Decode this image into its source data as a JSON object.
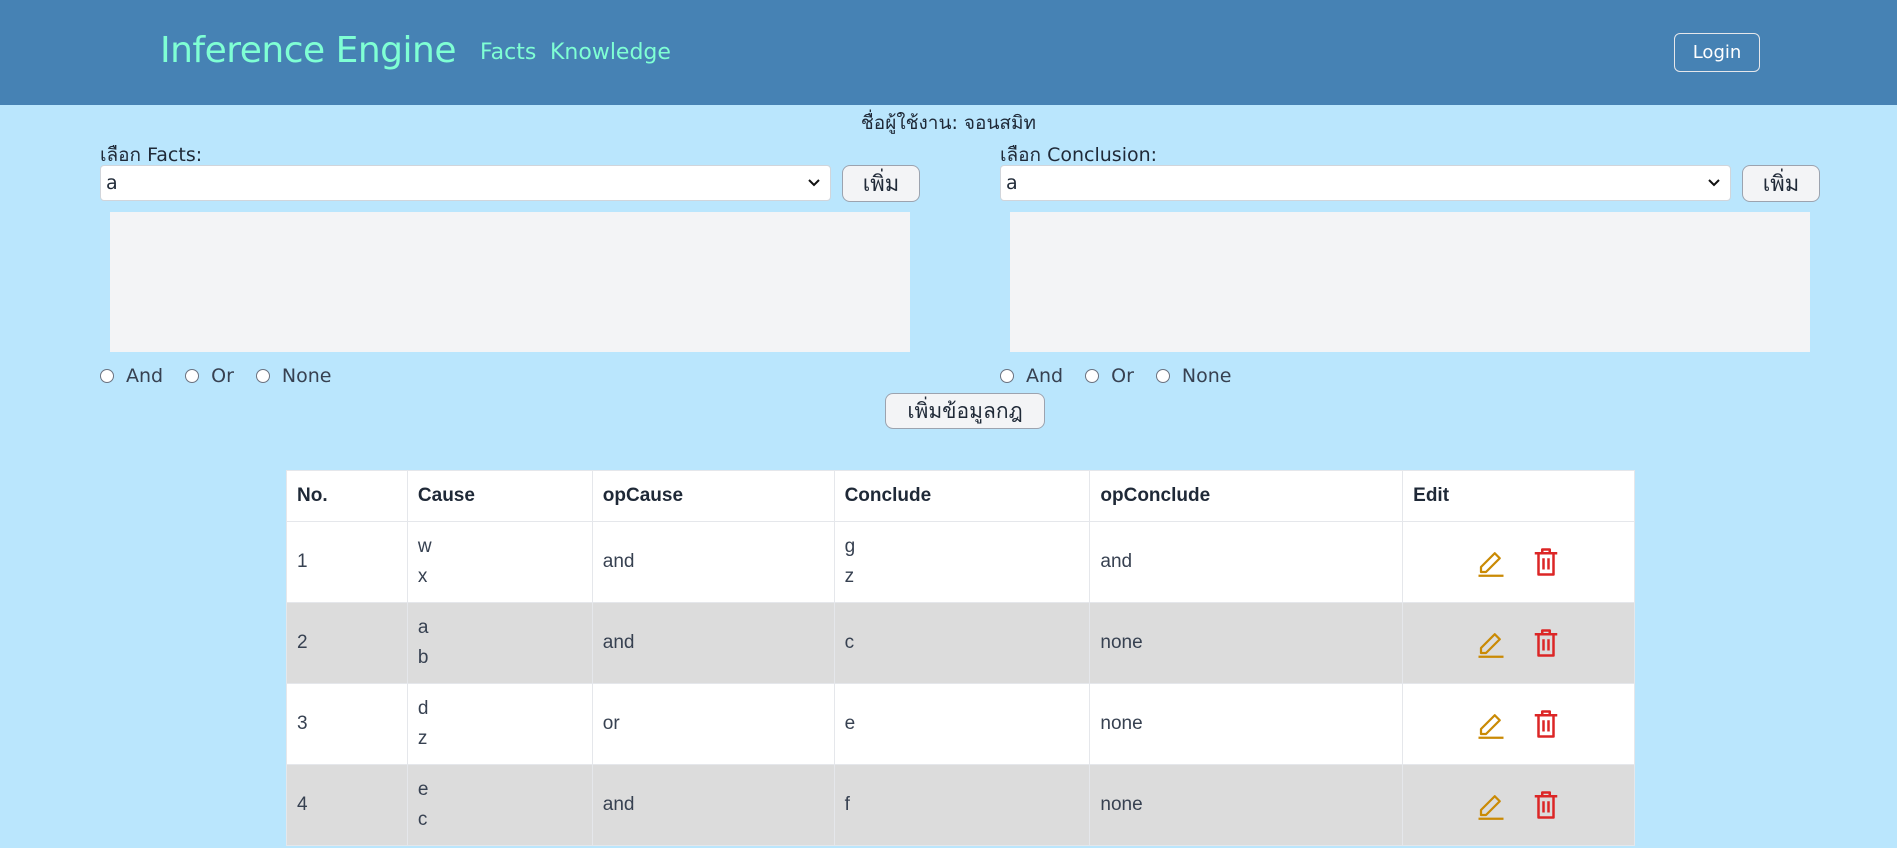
{
  "navbar": {
    "brand": "Inference Engine",
    "links": [
      {
        "label": "Facts"
      },
      {
        "label": "Knowledge"
      }
    ],
    "login_label": "Login",
    "bg_color": "#4682b4",
    "link_color": "#7fffd4"
  },
  "username_text": "ชื่อผู้ใช้งาน: จอนสมิท",
  "facts_panel": {
    "label": "เลือก Facts:",
    "selected": "a",
    "add_label": "เพิ่ม",
    "radios": [
      "And",
      "Or",
      "None"
    ]
  },
  "conclusion_panel": {
    "label": "เลือก Conclusion:",
    "selected": "a",
    "add_label": "เพิ่ม",
    "radios": [
      "And",
      "Or",
      "None"
    ]
  },
  "add_rule_label": "เพิ่มข้อมูลกฎ",
  "table": {
    "headers": [
      "No.",
      "Cause",
      "opCause",
      "Conclude",
      "opConclude",
      "Edit"
    ],
    "rows": [
      {
        "no": "1",
        "cause": [
          "w",
          "x"
        ],
        "opCause": "and",
        "conclude": [
          "g",
          "z"
        ],
        "opConclude": "and"
      },
      {
        "no": "2",
        "cause": [
          "a",
          "b"
        ],
        "opCause": "and",
        "conclude": [
          "c"
        ],
        "opConclude": "none"
      },
      {
        "no": "3",
        "cause": [
          "d",
          "z"
        ],
        "opCause": "or",
        "conclude": [
          "e"
        ],
        "opConclude": "none"
      },
      {
        "no": "4",
        "cause": [
          "e",
          "c"
        ],
        "opCause": "and",
        "conclude": [
          "f"
        ],
        "opConclude": "none"
      }
    ],
    "icons": {
      "edit": "pencil-icon",
      "delete": "trash-icon"
    },
    "colors": {
      "edit": "#ca8a04",
      "delete": "#dc2626",
      "alt_row": "#dcdcdc"
    }
  }
}
